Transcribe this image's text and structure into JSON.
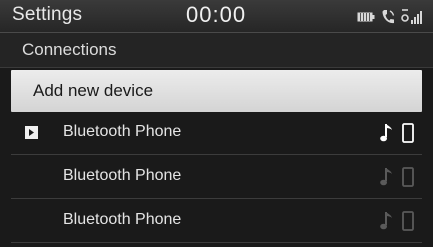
{
  "status_bar": {
    "title": "Settings",
    "clock": "00:00",
    "icons": [
      "battery-icon",
      "phone-call-icon",
      "signal-icon"
    ]
  },
  "section": {
    "title": "Connections"
  },
  "add_device": {
    "label": "Add new device"
  },
  "devices": [
    {
      "name": "Bluetooth Phone",
      "connected": true,
      "icons": [
        "music-note-icon",
        "phone-icon"
      ]
    },
    {
      "name": "Bluetooth Phone",
      "connected": false,
      "icons": [
        "music-note-icon",
        "phone-icon"
      ]
    },
    {
      "name": "Bluetooth Phone",
      "connected": false,
      "icons": [
        "music-note-icon",
        "phone-icon"
      ]
    }
  ],
  "colors": {
    "background": "#1a1a1a",
    "highlight": "#e0e0e0",
    "active_icon": "#ffffff",
    "inactive_icon": "#5a5a5a"
  }
}
